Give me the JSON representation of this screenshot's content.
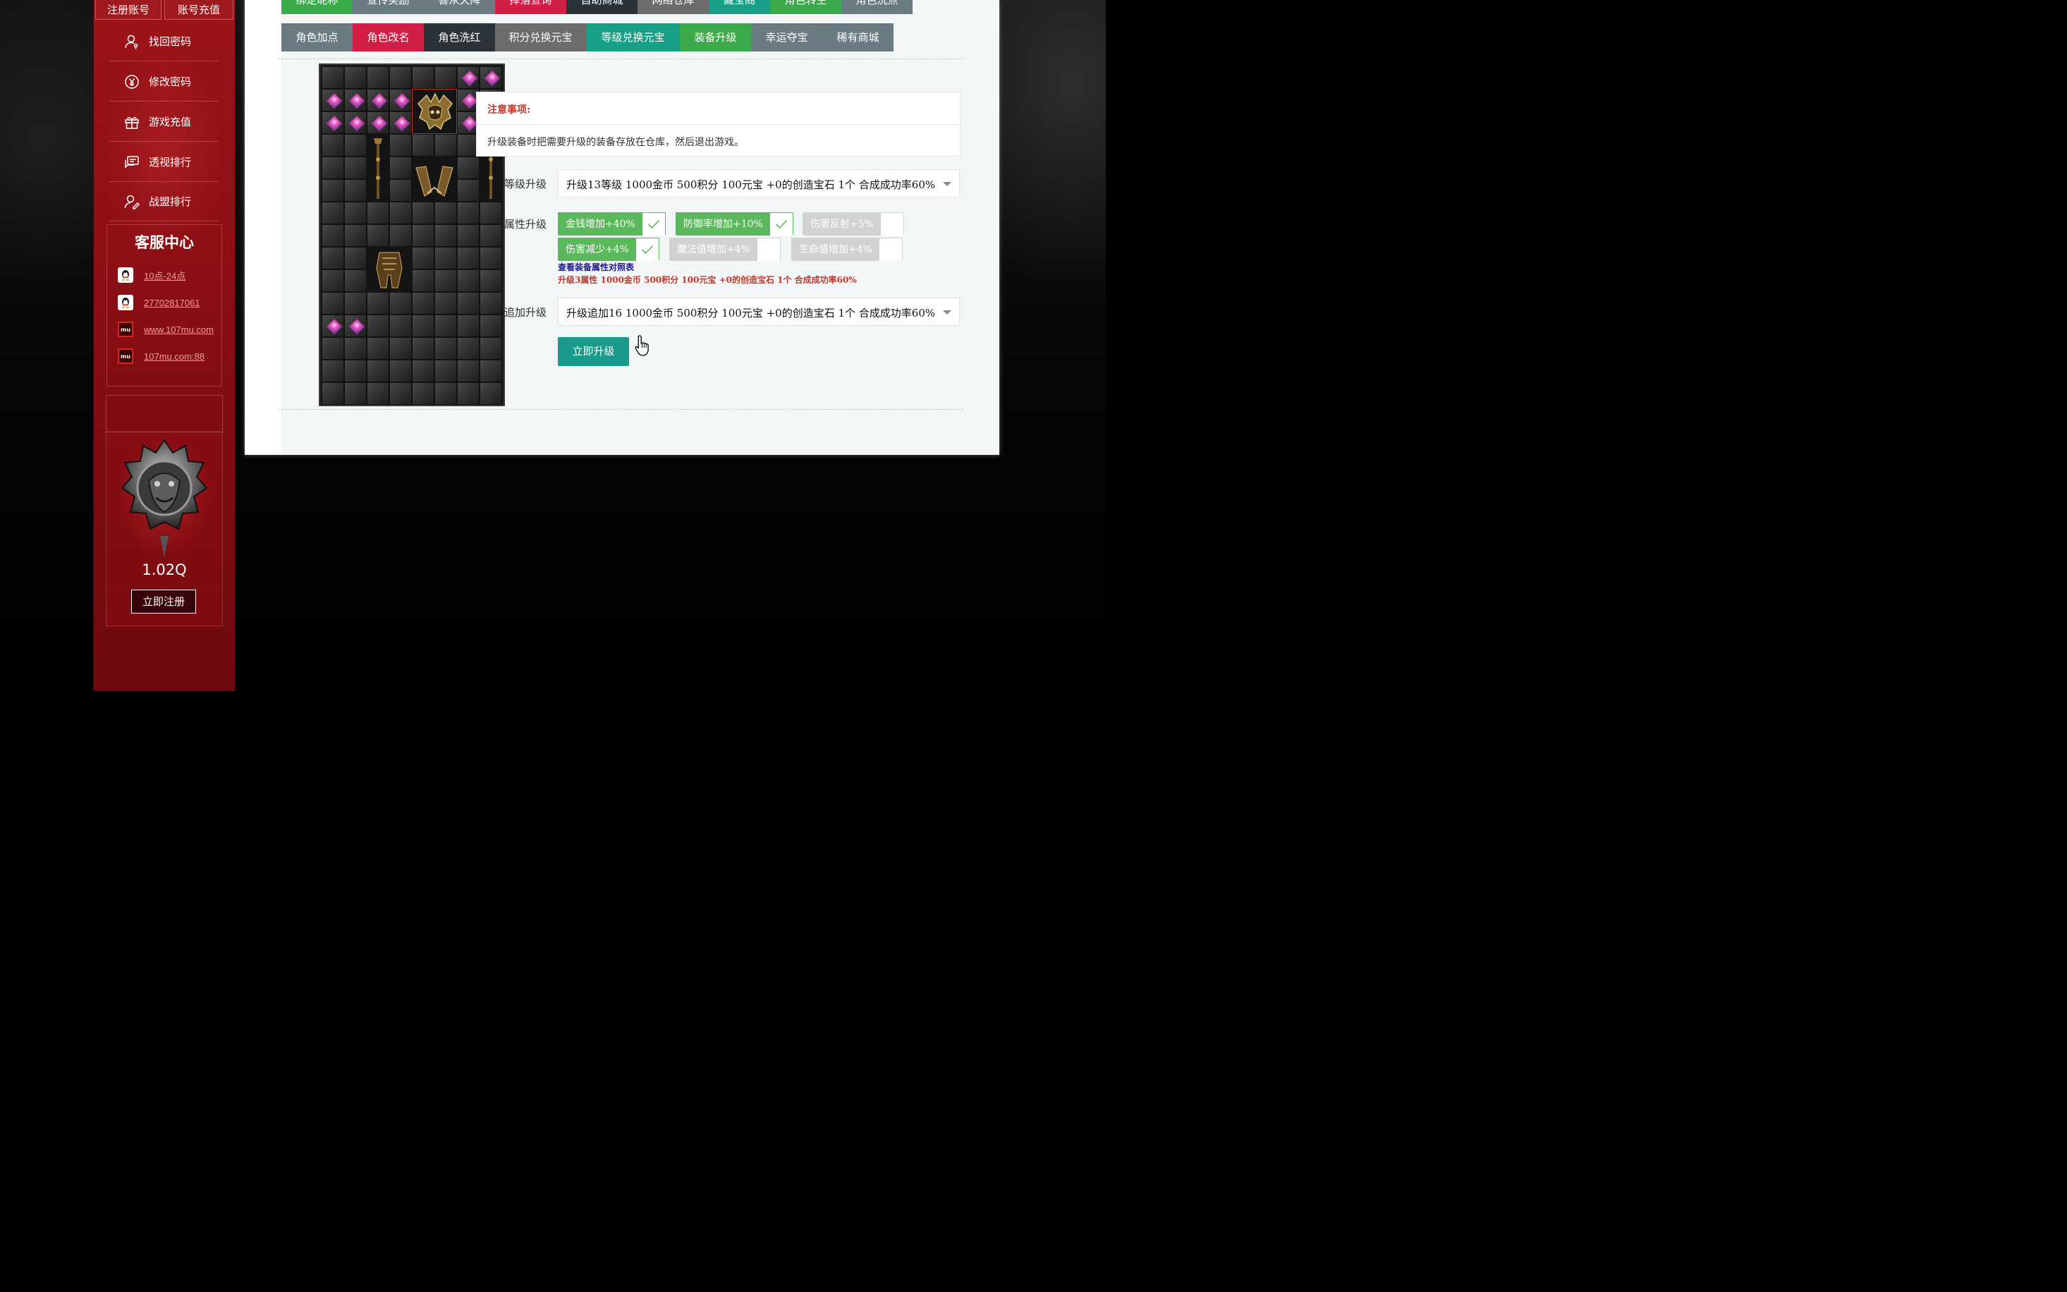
{
  "sidebar": {
    "top_buttons": [
      "注册账号",
      "账号充值"
    ],
    "menu": [
      {
        "label": "找回密码",
        "icon": "user-key-icon"
      },
      {
        "label": "修改密码",
        "icon": "yen-circle-icon"
      },
      {
        "label": "游戏充值",
        "icon": "gift-icon"
      },
      {
        "label": "透视排行",
        "icon": "chat-list-icon"
      },
      {
        "label": "战盟排行",
        "icon": "user-edit-icon"
      }
    ],
    "service": {
      "title": "客服中心",
      "rows": [
        {
          "icon": "qq-icon",
          "text": "10点-24点"
        },
        {
          "icon": "qq-icon",
          "text": "27702817061"
        },
        {
          "icon": "mu-logo-icon",
          "text": "www.107mu.com"
        },
        {
          "icon": "mu-logo-icon",
          "text": "107mu.com:88"
        }
      ]
    },
    "promo": {
      "value": "1.02Q",
      "button": "立即注册"
    }
  },
  "tabs_row1": [
    {
      "label": "绑定昵称",
      "color": "#3aaa4b"
    },
    {
      "label": "宣传奖励",
      "color": "#6a7b83"
    },
    {
      "label": "喜从天降",
      "color": "#6a7b83"
    },
    {
      "label": "掉落查询",
      "color": "#d11e44"
    },
    {
      "label": "自助商城",
      "color": "#2c3338"
    },
    {
      "label": "网络仓库",
      "color": "#6c6c6c"
    },
    {
      "label": "藏宝阁",
      "color": "#17a085"
    },
    {
      "label": "角色转生",
      "color": "#3aaa4b"
    },
    {
      "label": "角色洗点",
      "color": "#6a7b83"
    }
  ],
  "tabs_row2": [
    {
      "label": "角色加点",
      "color": "#6a7b83"
    },
    {
      "label": "角色改名",
      "color": "#d11e44"
    },
    {
      "label": "角色洗红",
      "color": "#2c3338"
    },
    {
      "label": "积分兑换元宝",
      "color": "#6c6c6c"
    },
    {
      "label": "等级兑换元宝",
      "color": "#17a085"
    },
    {
      "label": "装备升级",
      "color": "#3aaa4b"
    },
    {
      "label": "幸运夺宝",
      "color": "#6a7b83"
    },
    {
      "label": "稀有商城",
      "color": "#6a7b83"
    }
  ],
  "notice": {
    "title": "注意事项:",
    "text": "升级装备时把需要升级的装备存放在仓库，然后退出游戏。"
  },
  "form": {
    "level_label": "等级升级",
    "level_value": "升级13等级 1000金币 500积分 100元宝 +0的创造宝石 1个 合成成功率60%",
    "attr_label": "属性升级",
    "attributes": [
      {
        "label": "金钱增加+40%",
        "checked": true
      },
      {
        "label": "防御率增加+10%",
        "checked": true
      },
      {
        "label": "伤害反射+5%",
        "checked": false
      },
      {
        "label": "伤害减少+4%",
        "checked": true
      },
      {
        "label": "魔法值增加+4%",
        "checked": false
      },
      {
        "label": "生命值增加+4%",
        "checked": false
      }
    ],
    "attr_table_link": "查看装备属性对照表",
    "attr_cost": "升级3属性 1000金币 500积分 100元宝 +0的创造宝石 1个 合成成功率60%",
    "append_label": "追加升级",
    "append_value": "升级追加16 1000金币 500积分 100元宝 +0的创造宝石 1个 合成成功率60%",
    "submit": "立即升级"
  },
  "inventory": {
    "columns": 8,
    "rows": 15,
    "gem_slots": [
      [
        0,
        6
      ],
      [
        0,
        7
      ],
      [
        1,
        0
      ],
      [
        1,
        1
      ],
      [
        1,
        2
      ],
      [
        1,
        3
      ],
      [
        1,
        6
      ],
      [
        1,
        7
      ],
      [
        2,
        0
      ],
      [
        2,
        1
      ],
      [
        2,
        2
      ],
      [
        2,
        3
      ],
      [
        2,
        6
      ],
      [
        2,
        7
      ],
      [
        11,
        0
      ],
      [
        11,
        1
      ]
    ],
    "items": [
      {
        "name": "helm-item",
        "row": 1,
        "col": 4,
        "w": 2,
        "h": 2,
        "selected": true
      },
      {
        "name": "staff-item-left",
        "row": 3,
        "col": 2,
        "w": 1,
        "h": 3
      },
      {
        "name": "staff-item-right",
        "row": 3,
        "col": 7,
        "w": 1,
        "h": 3
      },
      {
        "name": "gloves-item",
        "row": 4,
        "col": 4,
        "w": 2,
        "h": 2
      },
      {
        "name": "armor-item",
        "row": 8,
        "col": 2,
        "w": 2,
        "h": 2
      }
    ]
  }
}
